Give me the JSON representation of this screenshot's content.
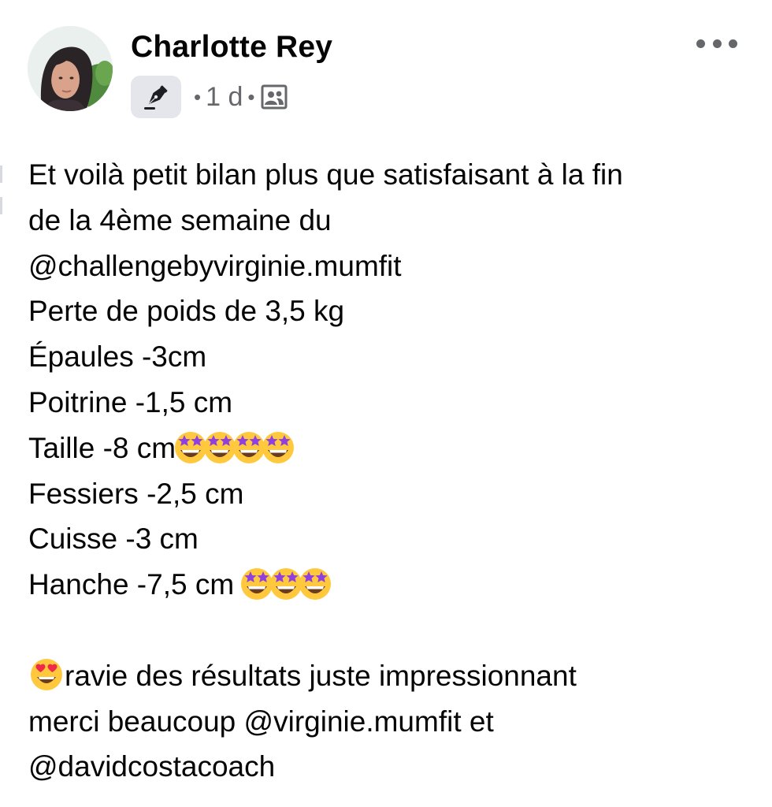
{
  "post": {
    "author": "Charlotte Rey",
    "timestamp": "1 d",
    "separator": "•",
    "badge_icon": "fountain-pen-icon",
    "audience_icon": "friends-audience-icon",
    "more_icon": "more-options-icon",
    "body": {
      "line1": "Et voilà petit bilan plus que satisfaisant à la fin",
      "line2": "de la 4ème semaine du",
      "line3": "@challengebyvirginie.mumfit",
      "line4": "Perte de poids de 3,5 kg",
      "line5": "Épaules -3cm",
      "line6": "Poitrine -1,5 cm",
      "line7": "Taille -8 cm",
      "line7_emoji_count": 4,
      "line8": "Fessiers -2,5 cm",
      "line9": "Cuisse -3 cm",
      "line10": "Hanche -7,5 cm ",
      "line10_emoji_count": 3,
      "line12": "ravie des résultats juste impressionnant",
      "line13": "merci beaucoup @virginie.mumfit et",
      "line14": "@davidcostacoach"
    },
    "emojis": {
      "star_struck": "star-struck-emoji",
      "heart_eyes": "heart-eyes-emoji"
    }
  },
  "colors": {
    "text_primary": "#050505",
    "text_secondary": "#65676b",
    "badge_bg": "#e4e6eb",
    "emoji_face": "#ffc83d",
    "emoji_star": "#8f3fe0",
    "emoji_heart": "#f02849"
  }
}
